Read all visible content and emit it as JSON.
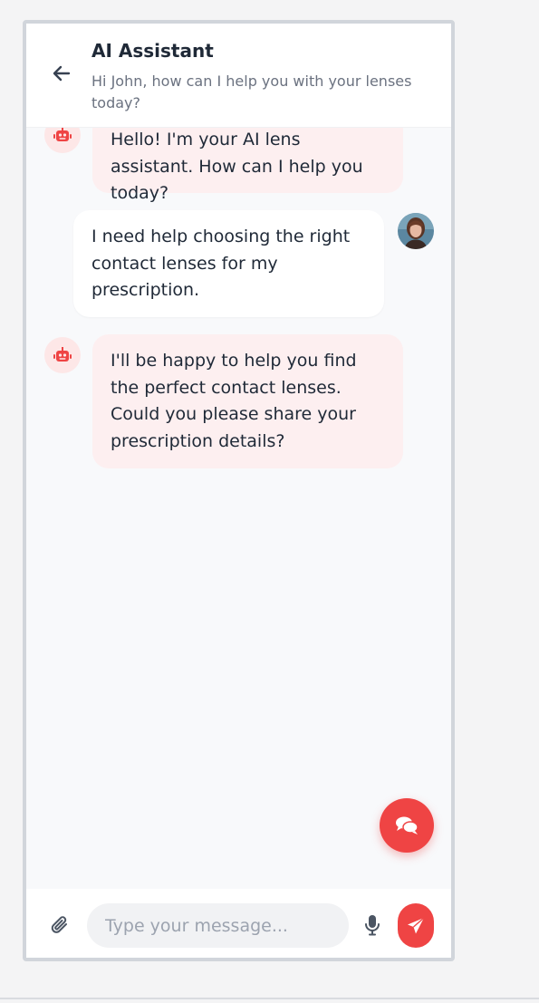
{
  "header": {
    "title": "AI Assistant",
    "subtitle": "Hi John, how can I help you with your lenses today?",
    "back_icon": "arrow-left-icon"
  },
  "messages": [
    {
      "sender": "bot",
      "text": "Hello! I'm your AI lens assistant. How can I help you today?",
      "avatar_icon": "robot-icon"
    },
    {
      "sender": "user",
      "text": "I need help choosing the right contact lenses for my prescription.",
      "avatar": "user-photo"
    },
    {
      "sender": "bot",
      "text": "I'll be happy to help you find the perfect contact lenses. Could you please share your prescription details?",
      "avatar_icon": "robot-icon"
    }
  ],
  "composer": {
    "placeholder": "Type your message...",
    "attach_icon": "paperclip-icon",
    "mic_icon": "microphone-icon",
    "send_icon": "paper-plane-icon"
  },
  "fab": {
    "icon": "chat-bubbles-icon"
  },
  "colors": {
    "accent": "#ef4444",
    "bot_bubble": "#fdeff0",
    "user_bubble": "#ffffff",
    "background": "#f8f9fb"
  }
}
